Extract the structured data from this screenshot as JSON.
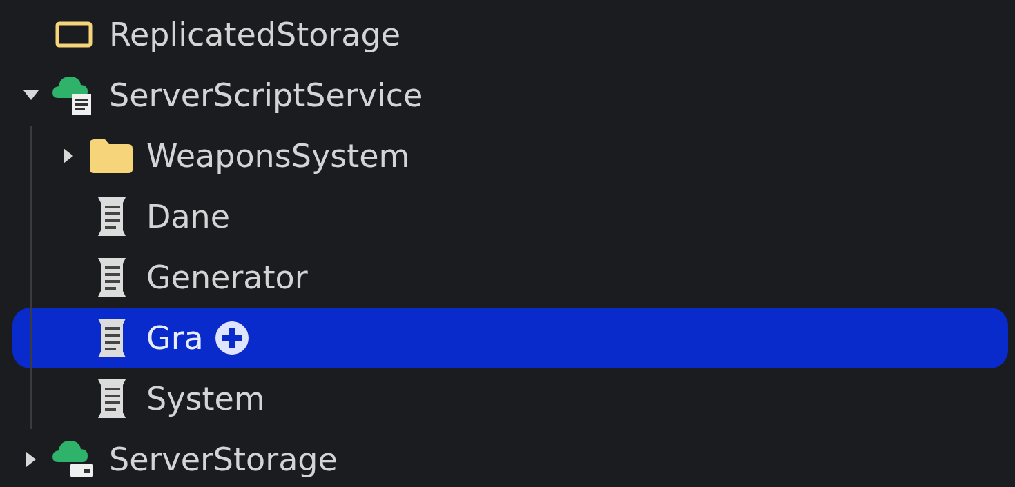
{
  "tree": [
    {
      "label": "ReplicatedStorage",
      "kind": "storage",
      "selected": false
    },
    {
      "label": "ServerScriptService",
      "kind": "service",
      "expanded": true,
      "selected": false,
      "children": [
        {
          "label": "WeaponsSystem",
          "kind": "folder",
          "expanded": false,
          "selected": false
        },
        {
          "label": "Dane",
          "kind": "script",
          "selected": false
        },
        {
          "label": "Generator",
          "kind": "script",
          "selected": false
        },
        {
          "label": "Gra",
          "kind": "script",
          "selected": true
        },
        {
          "label": "System",
          "kind": "script",
          "selected": false
        }
      ]
    },
    {
      "label": "ServerStorage",
      "kind": "storage-service",
      "expanded": false,
      "selected": false
    }
  ]
}
